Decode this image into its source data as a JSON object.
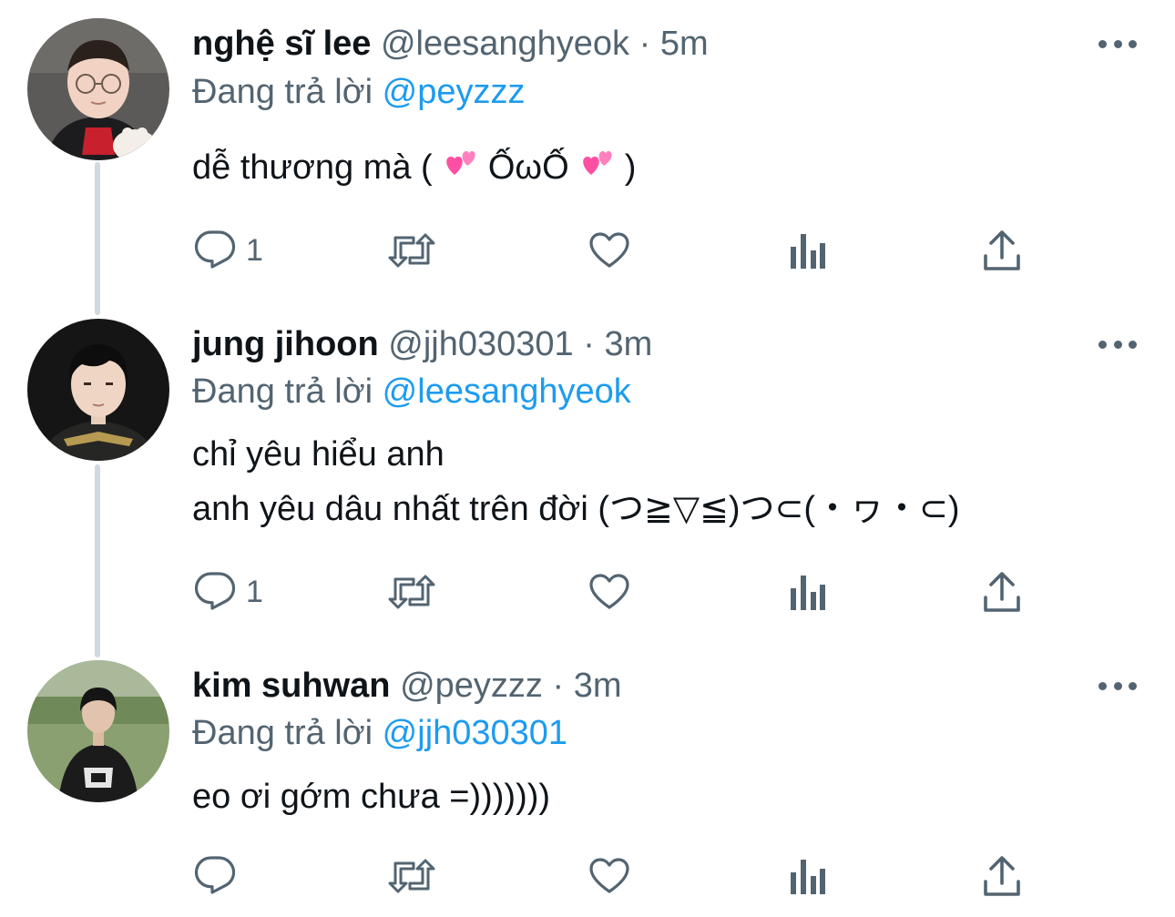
{
  "thread": [
    {
      "name": "nghệ sĩ lee",
      "handle": "@leesanghyeok",
      "separator": "·",
      "time": "5m",
      "reply_prefix": "Đang trả lời",
      "reply_to": "@peyzzz",
      "body_lines": [
        "dễ thương mà ( ",
        " Ố",
        "ω",
        "Ố ",
        " )"
      ],
      "reply_count": "1"
    },
    {
      "name": "jung jihoon",
      "handle": "@jjh030301",
      "separator": "·",
      "time": "3m",
      "reply_prefix": "Đang trả lời",
      "reply_to": "@leesanghyeok",
      "body_lines": [
        "chỉ yêu hiểu anh",
        "anh yêu dâu nhất trên đời (つ≧▽≦)つ⊂(・ヮ・⊂)"
      ],
      "reply_count": "1"
    },
    {
      "name": "kim suhwan",
      "handle": "@peyzzz",
      "separator": "·",
      "time": "3m",
      "reply_prefix": "Đang trả lời",
      "reply_to": "@jjh030301",
      "body_lines": [
        "eo ơi gớm chưa =)))))))"
      ],
      "reply_count": ""
    }
  ],
  "icons": {
    "reply": "reply-icon",
    "retweet": "retweet-icon",
    "like": "like-icon",
    "views": "views-icon",
    "share": "share-icon",
    "more": "more-icon",
    "emoji": "two-hearts-emoji"
  },
  "colors": {
    "text": "#0f1419",
    "secondary": "#536471",
    "link": "#1d9bf0",
    "thread_line": "#cfd9de",
    "heart_emoji": "#ff4fa3"
  }
}
